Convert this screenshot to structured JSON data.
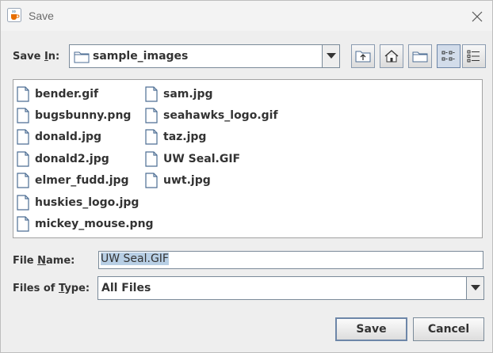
{
  "window": {
    "title": "Save",
    "app_icon": "java-cup-icon",
    "close_icon": "close-icon"
  },
  "save_in": {
    "label_pre": "Save ",
    "label_mn": "I",
    "label_post": "n:",
    "value": "sample_images",
    "folder_icon": "folder-icon"
  },
  "toolbar": {
    "buttons": [
      {
        "name": "up-one-level-button",
        "icon": "up-folder-icon"
      },
      {
        "name": "home-button",
        "icon": "home-icon"
      },
      {
        "name": "new-folder-button",
        "icon": "new-folder-icon"
      },
      {
        "name": "list-view-button",
        "icon": "list-view-icon",
        "active": true
      },
      {
        "name": "details-view-button",
        "icon": "details-view-icon",
        "active": false
      }
    ]
  },
  "files": {
    "col1": [
      "bender.gif",
      "bugsbunny.png",
      "donald.jpg",
      "donald2.jpg",
      "elmer_fudd.jpg",
      "huskies_logo.jpg",
      "mickey_mouse.png"
    ],
    "col2": [
      "sam.jpg",
      "seahawks_logo.gif",
      "taz.jpg",
      "UW Seal.GIF",
      "uwt.jpg"
    ]
  },
  "file_name": {
    "label_pre": "File ",
    "label_mn": "N",
    "label_post": "ame:",
    "value": "UW Seal.GIF"
  },
  "file_type": {
    "label_pre": "Files of ",
    "label_mn": "T",
    "label_post": "ype:",
    "value": "All Files"
  },
  "buttons": {
    "save": "Save",
    "cancel": "Cancel"
  },
  "colors": {
    "selection": "#b8cfe5",
    "default_border": "#6d86a8",
    "background": "#eeeeee"
  }
}
